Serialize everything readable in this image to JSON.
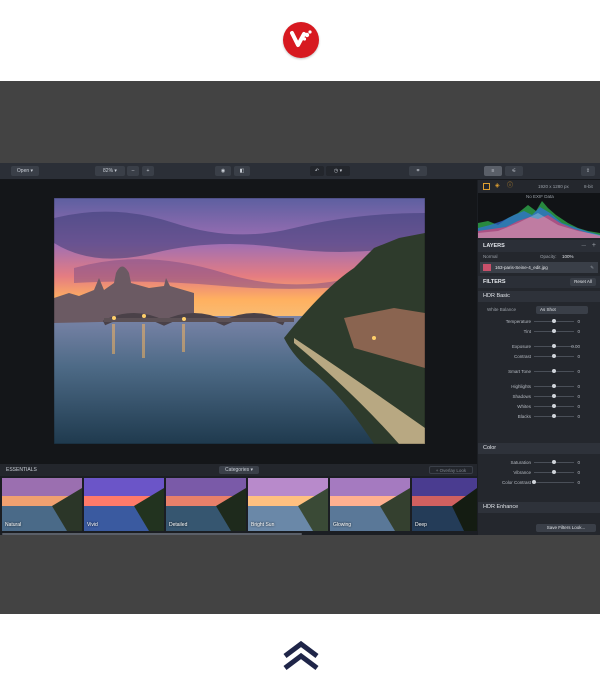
{
  "toolbar": {
    "open_label": "Open",
    "zoom_value": "82%",
    "zoom_out": "–",
    "zoom_in": "+"
  },
  "panel": {
    "image_size": "1920 x 1280 px",
    "bit_depth": "8-bit",
    "exif": "No EXIF Data",
    "layers_title": "LAYERS",
    "blend_mode": "Normal",
    "opacity_label": "Opacity:",
    "opacity_value": "100%",
    "layer_name": "163-paris-Seine-4_edit.jpg",
    "filters_title": "FILTERS",
    "reset_all": "Reset All",
    "hdr_basic": "HDR Basic",
    "white_balance_label": "White Balance",
    "white_balance_value": "As Shot",
    "sliders_hdr": [
      {
        "name": "Temperature",
        "value": "0",
        "pos": 0.5
      },
      {
        "name": "Tint",
        "value": "0",
        "pos": 0.5
      },
      {
        "name": "Exposure",
        "value": "0.00",
        "pos": 0.5
      },
      {
        "name": "Contrast",
        "value": "0",
        "pos": 0.5
      },
      {
        "name": "Smart Tone",
        "value": "0",
        "pos": 0.5
      },
      {
        "name": "Highlights",
        "value": "0",
        "pos": 0.5
      },
      {
        "name": "Shadows",
        "value": "0",
        "pos": 0.5
      },
      {
        "name": "Whites",
        "value": "0",
        "pos": 0.5
      },
      {
        "name": "Blacks",
        "value": "0",
        "pos": 0.5
      }
    ],
    "color_title": "Color",
    "sliders_color": [
      {
        "name": "Saturation",
        "value": "0",
        "pos": 0.5
      },
      {
        "name": "Vibrance",
        "value": "0",
        "pos": 0.5
      },
      {
        "name": "Color Contrast",
        "value": "0",
        "pos": 0.0
      }
    ],
    "hdr_enhance": "HDR Enhance",
    "save_filters": "Save Filters Look..."
  },
  "strip": {
    "essentials": "ESSENTIALS",
    "categories": "Categories",
    "overlay_look": "+ Overlay Look",
    "looks": [
      "Natural",
      "Vivid",
      "Detailed",
      "Bright Sun",
      "Glowing",
      "Deep"
    ]
  },
  "colors": {
    "brand_red": "#d71920",
    "navy": "#1f2548"
  }
}
